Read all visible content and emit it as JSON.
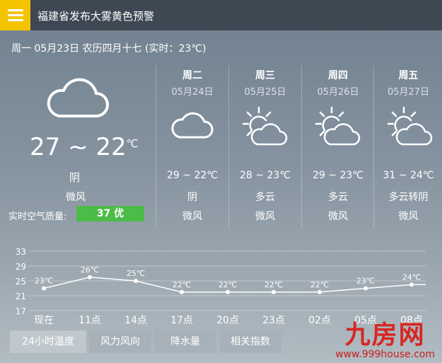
{
  "header": {
    "title": "福建省发布大雾黄色预警"
  },
  "date_line": "周一 05月23日 农历四月十七 (实时：23℃)",
  "today": {
    "temp_range": "27 ~ 22",
    "temp_unit": "℃",
    "condition": "阴",
    "wind": "微风",
    "aqi_label": "实时空气质量:",
    "aqi_value": "37 优",
    "icon": "cloud-icon"
  },
  "forecast": [
    {
      "dow": "周二",
      "date": "05月24日",
      "temp": "29 ~ 22℃",
      "condition": "阴",
      "wind": "微风",
      "icon": "cloud-icon"
    },
    {
      "dow": "周三",
      "date": "05月25日",
      "temp": "28 ~ 23℃",
      "condition": "多云",
      "wind": "微风",
      "icon": "partly-cloudy-icon"
    },
    {
      "dow": "周四",
      "date": "05月26日",
      "temp": "29 ~ 23℃",
      "condition": "多云",
      "wind": "微风",
      "icon": "partly-cloudy-icon"
    },
    {
      "dow": "周五",
      "date": "05月27日",
      "temp": "31 ~ 24℃",
      "condition": "多云转阴",
      "wind": "微风",
      "icon": "partly-cloudy-icon"
    }
  ],
  "chart_data": {
    "type": "line",
    "categories": [
      "现在",
      "11点",
      "14点",
      "17点",
      "20点",
      "23点",
      "02点",
      "05点",
      "08点"
    ],
    "values": [
      23,
      26,
      25,
      22,
      22,
      22,
      22,
      23,
      24
    ],
    "labels": [
      "23℃",
      "26℃",
      "25℃",
      "22℃",
      "22℃",
      "22℃",
      "22℃",
      "23℃",
      "24℃"
    ],
    "yticks": [
      33,
      29,
      25,
      21,
      17
    ],
    "ylim": [
      17,
      33
    ],
    "grid": true
  },
  "tabs": [
    "24小时温度",
    "风力风向",
    "降水量",
    "相关指数"
  ],
  "watermark": {
    "text": "九房网",
    "url": "www.999house.com"
  }
}
